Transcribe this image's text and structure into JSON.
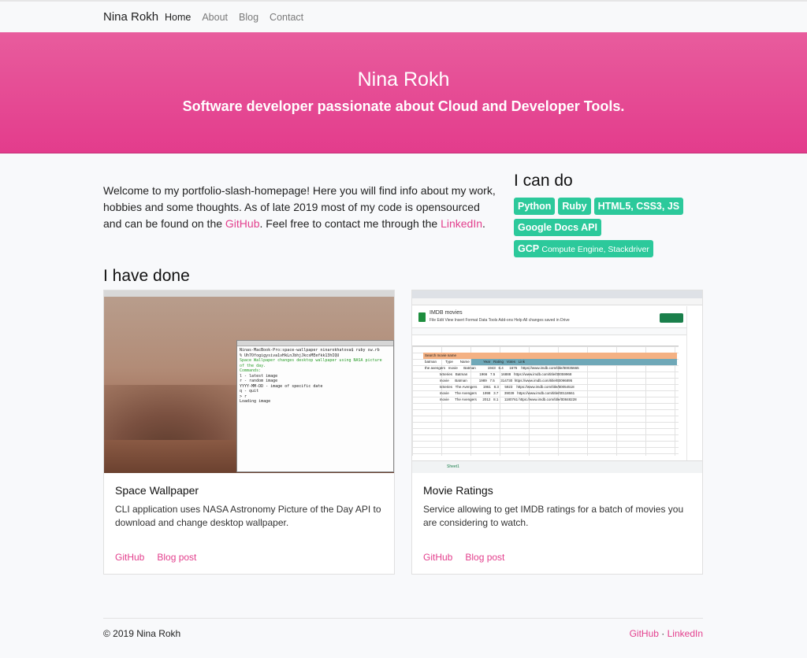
{
  "navbar": {
    "brand": "Nina Rokh",
    "links": [
      {
        "label": "Home",
        "active": true
      },
      {
        "label": "About",
        "active": false
      },
      {
        "label": "Blog",
        "active": false
      },
      {
        "label": "Contact",
        "active": false
      }
    ]
  },
  "hero": {
    "title": "Nina Rokh",
    "subtitle": "Software developer passionate about Cloud and Developer Tools."
  },
  "intro": {
    "text_before": "Welcome to my portfolio-slash-homepage! Here you will find info about my work, hobbies and some thoughts. As of late 2019 most of my code is opensourced and can be found on the ",
    "github_link": "GitHub",
    "text_middle": ". Feel free to contact me through the ",
    "linkedin_link": "LinkedIn",
    "text_after": "."
  },
  "skills": {
    "title": "I can do",
    "badges": [
      {
        "label": "Python"
      },
      {
        "label": "Ruby"
      },
      {
        "label": "HTML5, CSS3, JS"
      },
      {
        "label": "Google Docs API"
      },
      {
        "label": "GCP",
        "small": "Compute Engine, Stackdriver"
      }
    ],
    "badge_color": "#2cc99b"
  },
  "projects": {
    "title": "I have done",
    "items": [
      {
        "title": "Space Wallpaper",
        "description": "CLI application uses NASA Astronomy Picture of the Day API to download and change desktop wallpaper.",
        "links": [
          "GitHub",
          "Blog post"
        ]
      },
      {
        "title": "Movie Ratings",
        "description": "Service allowing to get IMDB ratings for a batch of movies you are considering to watch.",
        "links": [
          "GitHub",
          "Blog post"
        ]
      }
    ]
  },
  "terminal": {
    "lines": [
      "Ninas-MacBook-Pro:space-wallpaper ninarokhatova$ ruby sw.rb",
      "% Uh7Ofogigysiva1vHkLnJbhjJkcsMEefkk13hIQU",
      "Space Wallpaper changes desktop wallpaper using NASA picture",
      "of the day.",
      "Commands:",
      "  l - latest image",
      "  r - random image",
      "  YYYY-MM-DD - image of specific date",
      "  q - quit",
      "> r",
      "Loading image"
    ]
  },
  "sheet": {
    "name": "IMDB movies",
    "menu": "File  Edit  View  Insert  Format  Data  Tools  Add-ons  Help   All changes saved in Drive",
    "search_label": "Search movie name",
    "rows": [
      "batman         Type       Name              Year   Rating   Votes   Link",
      "the avengers   movie      Batman            1943   6.4      1676    https://www.imdb.com/title/tt0035665",
      "               tvSeries   Batman            1966   7.5      16888   https://www.imdb.com/title/tt0059968",
      "               movie      Batman            1989   7.5      314730  https://www.imdb.com/title/tt0096895",
      "               tvSeries   The Avengers      1961   8.3      5923    https://www.imdb.com/title/tt0054518",
      "               movie      The Avengers      1998   3.7      39039   https://www.imdb.com/title/tt0118661",
      "               movie      The Avengers      2012   8.1      1180761 https://www.imdb.com/title/tt0848228"
    ],
    "tab": "Sheet1"
  },
  "footer": {
    "copyright": "© 2019 Nina Rokh",
    "links": [
      "GitHub",
      "LinkedIn"
    ],
    "separator": " · "
  }
}
